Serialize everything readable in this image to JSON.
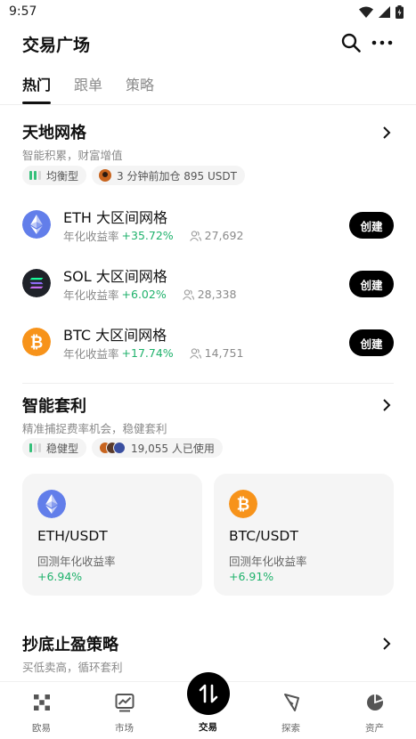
{
  "status_bar": {
    "time": "9:57"
  },
  "header": {
    "title": "交易广场"
  },
  "tabs": [
    {
      "label": "热门",
      "active": true
    },
    {
      "label": "跟单",
      "active": false
    },
    {
      "label": "策略",
      "active": false
    }
  ],
  "grid_section": {
    "title": "天地网格",
    "subtitle": "智能积累，财富增值",
    "chips": [
      "均衡型",
      "3 分钟前加仓 895 USDT"
    ],
    "apy_prefix": "年化收益率",
    "rows": [
      {
        "name": "ETH 大区间网格",
        "apy": "+35.72%",
        "users": "27,692",
        "button": "创建",
        "icon": "eth-icon"
      },
      {
        "name": "SOL 大区间网格",
        "apy": "+6.02%",
        "users": "28,338",
        "button": "创建",
        "icon": "sol-icon"
      },
      {
        "name": "BTC 大区间网格",
        "apy": "+17.74%",
        "users": "14,751",
        "button": "创建",
        "icon": "btc-icon"
      }
    ]
  },
  "arb_section": {
    "title": "智能套利",
    "subtitle": "精准捕捉费率机会，稳健套利",
    "chips": [
      "稳健型",
      "19,055 人已使用"
    ],
    "cards": [
      {
        "pair": "ETH/USDT",
        "label": "回测年化收益率",
        "value": "+6.94%",
        "icon": "eth-icon"
      },
      {
        "pair": "BTC/USDT",
        "label": "回测年化收益率",
        "value": "+6.91%",
        "icon": "btc-icon"
      }
    ]
  },
  "dip_section": {
    "title": "抄底止盈策略",
    "subtitle": "买低卖高，循环套利"
  },
  "tabbar": {
    "items": [
      {
        "label": "欧易",
        "icon": "okx-logo-icon"
      },
      {
        "label": "市场",
        "icon": "chart-icon"
      },
      {
        "label": "交易",
        "icon": "trade-arrows-icon"
      },
      {
        "label": "探索",
        "icon": "compass-icon"
      },
      {
        "label": "资产",
        "icon": "pie-chart-icon"
      }
    ]
  },
  "colors": {
    "accent": "#000000",
    "positive": "#20b26c",
    "eth": "#627eea",
    "btc": "#f7931a",
    "sol_bg": "#1f2229"
  }
}
